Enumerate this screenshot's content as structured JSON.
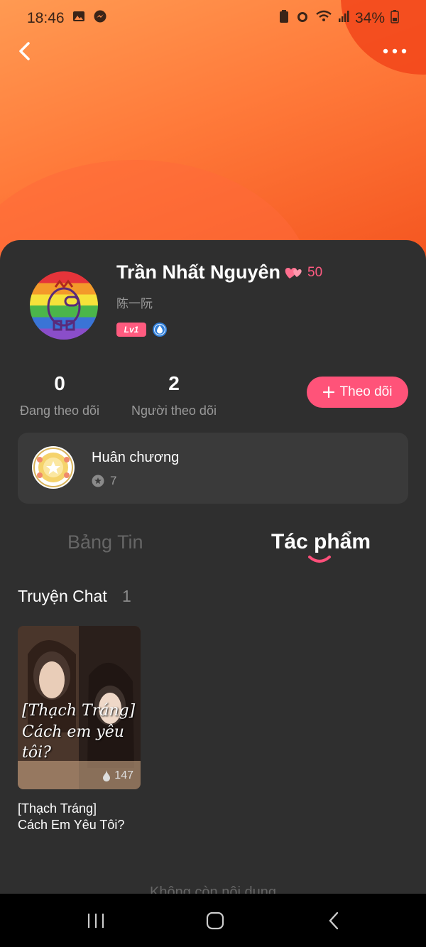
{
  "status_bar": {
    "time": "18:46",
    "battery": "34%"
  },
  "profile": {
    "name": "Trần Nhất Nguyên",
    "heart_count": "50",
    "subname": "陈一阮",
    "level": "Lv1"
  },
  "stats": {
    "following_count": "0",
    "following_label": "Đang theo dõi",
    "followers_count": "2",
    "followers_label": "Người theo dõi"
  },
  "follow_button": {
    "label": "Theo dõi"
  },
  "medal": {
    "title": "Huân chương",
    "count": "7"
  },
  "tabs": {
    "feed": "Bảng Tin",
    "works": "Tác phẩm"
  },
  "section": {
    "title": "Truyện Chat",
    "count": "1"
  },
  "story": {
    "cover_text": "[Thạch Tráng] Cách em yêu tôi?",
    "views": "147",
    "title": "[Thạch Tráng]\nCách Em Yêu Tôi?"
  },
  "footer": {
    "text": "Không còn nội dung"
  },
  "colors": {
    "accent": "#ff5379",
    "hero_orange": "#ff7a3a",
    "panel_bg": "#2f2f2f"
  }
}
